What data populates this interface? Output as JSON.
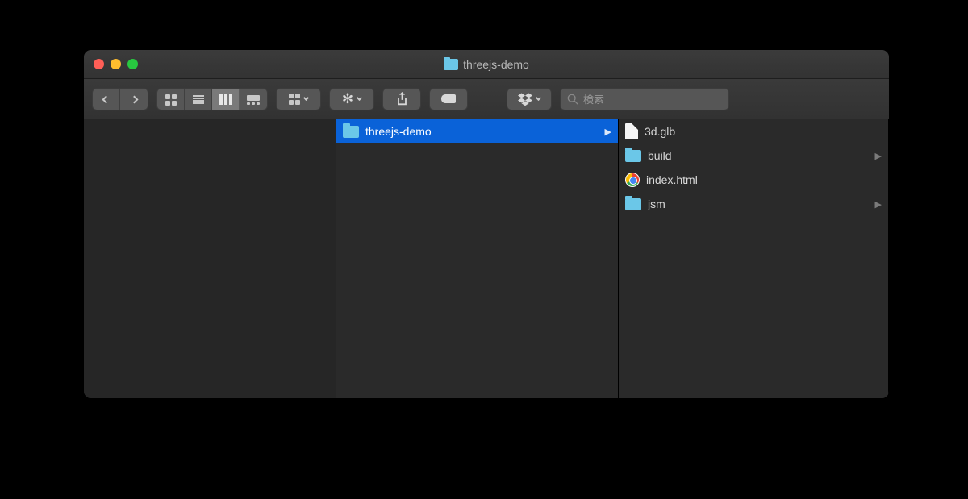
{
  "window": {
    "title": "threejs-demo"
  },
  "search": {
    "placeholder": "検索"
  },
  "columns": {
    "col2": {
      "items": [
        {
          "name": "threejs-demo",
          "type": "folder",
          "selected": true,
          "has_children": true
        }
      ]
    },
    "col3": {
      "items": [
        {
          "name": "3d.glb",
          "type": "file",
          "has_children": false
        },
        {
          "name": "build",
          "type": "folder",
          "has_children": true
        },
        {
          "name": "index.html",
          "type": "chrome",
          "has_children": false
        },
        {
          "name": "jsm",
          "type": "folder",
          "has_children": true
        }
      ]
    }
  }
}
